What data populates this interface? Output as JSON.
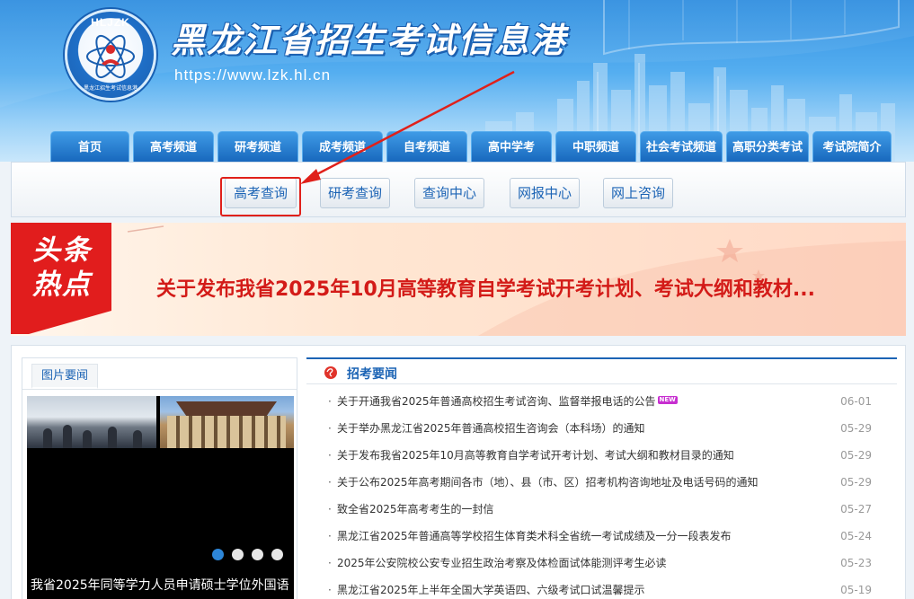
{
  "header": {
    "logo_text": "HLJZK",
    "logo_subtext": "黑龙江招生考试信息港",
    "site_title": "黑龙江省招生考试信息港",
    "url": "https://www.lzk.hl.cn"
  },
  "main_nav": [
    {
      "label": "首页"
    },
    {
      "label": "高考频道"
    },
    {
      "label": "研考频道"
    },
    {
      "label": "成考频道"
    },
    {
      "label": "自考频道"
    },
    {
      "label": "高中学考"
    },
    {
      "label": "中职频道"
    },
    {
      "label": "社会考试频道"
    },
    {
      "label": "高职分类考试"
    },
    {
      "label": "考试院简介"
    }
  ],
  "sub_nav": [
    {
      "label": "高考查询",
      "highlighted": true
    },
    {
      "label": "研考查询"
    },
    {
      "label": "查询中心"
    },
    {
      "label": "网报中心"
    },
    {
      "label": "网上咨询"
    }
  ],
  "headline": {
    "badge_line1": "头条",
    "badge_line2": "热点",
    "text": "关于发布我省2025年10月高等教育自学考试开考计划、考试大纲和教材..."
  },
  "pictures": {
    "tab_label": "图片要闻",
    "caption": "我省2025年同等学力人员申请硕士学位外国语",
    "slide_count": 4,
    "active_slide": 1
  },
  "news": {
    "title": "招考要闻",
    "items": [
      {
        "text": "关于开通我省2025年普通高校招生考试咨询、监督举报电话的公告",
        "date": "06-01",
        "is_new": true,
        "new_label": "NEW"
      },
      {
        "text": "关于举办黑龙江省2025年普通高校招生咨询会（本科场）的通知",
        "date": "05-29"
      },
      {
        "text": "关于发布我省2025年10月高等教育自学考试开考计划、考试大纲和教材目录的通知",
        "date": "05-29"
      },
      {
        "text": "关于公布2025年高考期间各市（地）、县（市、区）招考机构咨询地址及电话号码的通知",
        "date": "05-29"
      },
      {
        "text": "致全省2025年高考考生的一封信",
        "date": "05-27"
      },
      {
        "text": "黑龙江省2025年普通高等学校招生体育类术科全省统一考试成绩及一分一段表发布",
        "date": "05-24"
      },
      {
        "text": "2025年公安院校公安专业招生政治考察及体检面试体能测评考生必读",
        "date": "05-23"
      },
      {
        "text": "黑龙江省2025年上半年全国大学英语四、六级考试口试温馨提示",
        "date": "05-19"
      }
    ]
  },
  "colors": {
    "brand_blue": "#1c64b5",
    "headline_red": "#d31b18",
    "highlight_red": "#e0201a"
  }
}
